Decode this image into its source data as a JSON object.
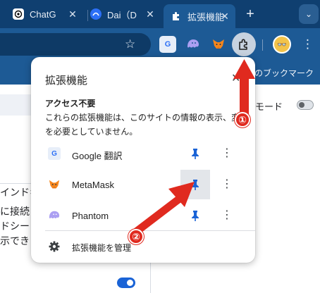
{
  "tabs": [
    {
      "title": "ChatG",
      "favicon": "chatgpt-icon",
      "close": "✕"
    },
    {
      "title": "Dai（D",
      "favicon": "dai-icon",
      "close": "✕"
    },
    {
      "title": "拡張機能",
      "favicon": "puzzle-icon",
      "close": "✕",
      "active": true
    }
  ],
  "new_tab": "+",
  "tab_menu": "⌄",
  "toolbar": {
    "bookmark_star": "☆",
    "extensions": [
      {
        "name": "Google 翻訳",
        "icon": "google-translate-icon",
        "glyph": "G"
      },
      {
        "name": "Phantom",
        "icon": "phantom-icon"
      },
      {
        "name": "MetaMask",
        "icon": "metamask-icon"
      }
    ],
    "profile_glyph": "👓",
    "menu": "⋮"
  },
  "bookmarks_bar": {
    "text": "のブックマーク"
  },
  "background": {
    "mode_label": "モード",
    "lines": [
      "インドキ",
      "に接続し",
      "ドシート",
      "示できま"
    ]
  },
  "popup": {
    "title": "拡張機能",
    "close": "✕",
    "section_heading": "アクセス不要",
    "section_desc": "これらの拡張機能は、このサイトの情報の表示、変更を必要としていません。",
    "extensions": [
      {
        "name": "Google 翻訳",
        "icon": "google-translate-icon",
        "glyph": "G",
        "pinned": true
      },
      {
        "name": "MetaMask",
        "icon": "metamask-icon",
        "pinned": true
      },
      {
        "name": "Phantom",
        "icon": "phantom-icon",
        "pinned": true
      }
    ],
    "row_menu": "⋮",
    "manage_label": "拡張機能を管理"
  },
  "annotations": [
    {
      "number": "①",
      "target": "extensions-puzzle-button"
    },
    {
      "number": "②",
      "target": "metamask-pin"
    }
  ],
  "colors": {
    "tab_strip": "#0f3f70",
    "toolbar": "#1d5a95",
    "pin_blue": "#1a63d6",
    "annotation_red": "#e02a1f"
  }
}
